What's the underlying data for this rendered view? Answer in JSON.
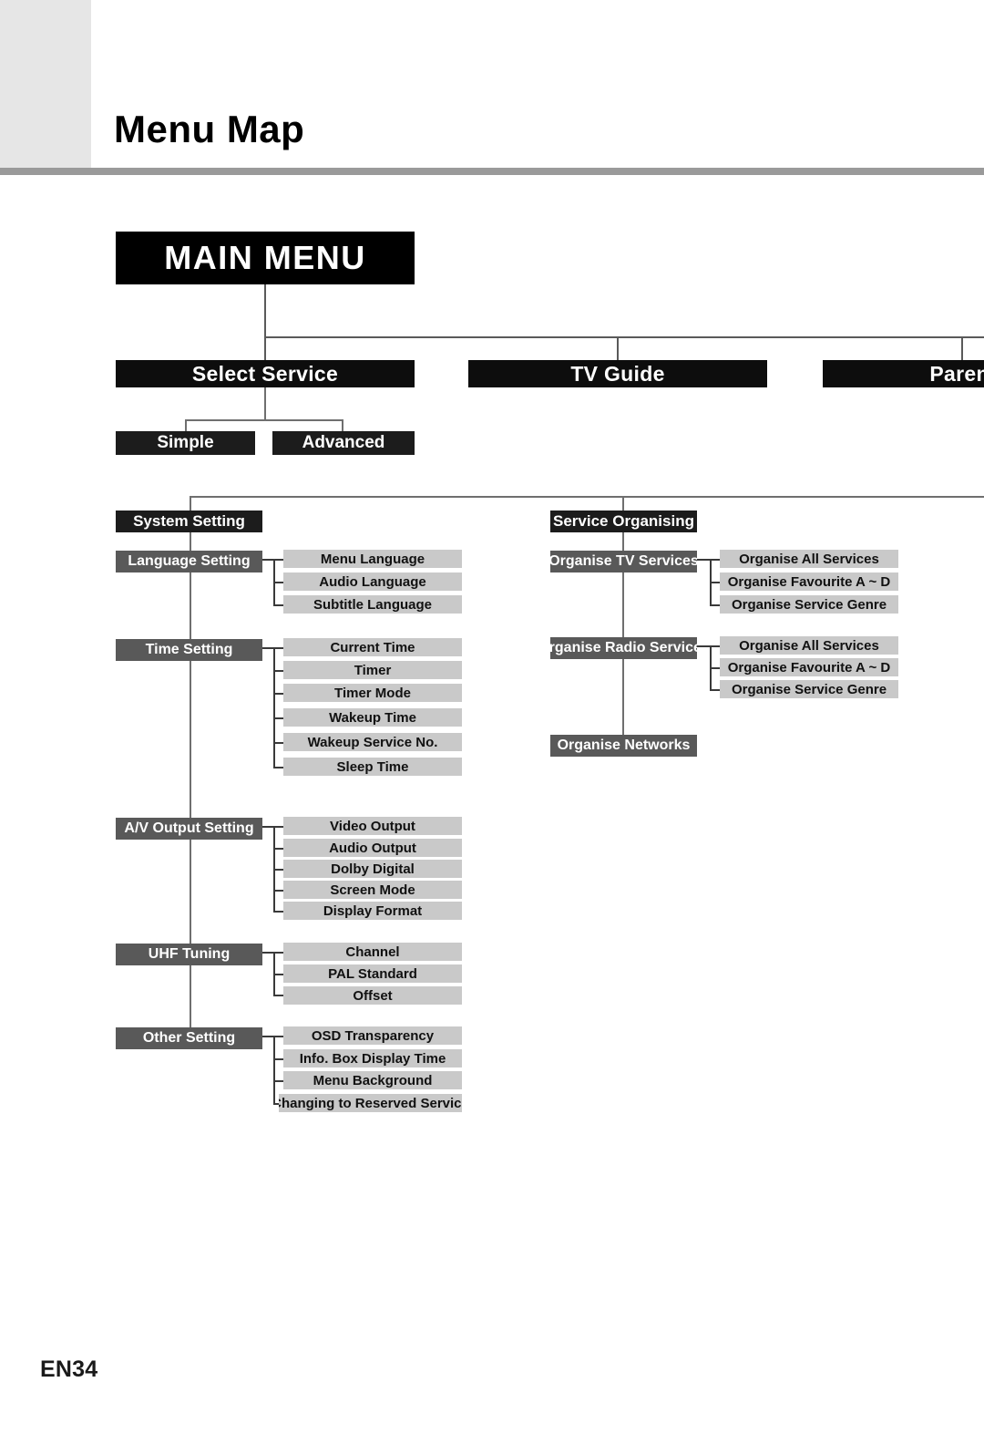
{
  "page": {
    "title": "Menu Map",
    "footer": "EN34"
  },
  "colors": {
    "root_box": "#000000",
    "level1_box": "#0d0d0d",
    "group_box": "#595959",
    "leaf_box": "#c9c9c9",
    "header_rule": "#9a9a9a",
    "corner_block": "#e6e6e6",
    "connector": "#5a5a5a"
  },
  "tree": {
    "root": {
      "label": "MAIN MENU"
    },
    "level1": [
      {
        "label": "Select Service"
      },
      {
        "label": "TV Guide"
      },
      {
        "label": "Parental"
      }
    ],
    "select_service_children": [
      {
        "label": "Simple"
      },
      {
        "label": "Advanced"
      }
    ],
    "sections": [
      {
        "label": "System Setting",
        "groups": [
          {
            "label": "Language Setting",
            "items": [
              {
                "label": "Menu Language"
              },
              {
                "label": "Audio Language"
              },
              {
                "label": "Subtitle Language"
              }
            ]
          },
          {
            "label": "Time Setting",
            "items": [
              {
                "label": "Current Time"
              },
              {
                "label": "Timer"
              },
              {
                "label": "Timer Mode"
              },
              {
                "label": "Wakeup Time"
              },
              {
                "label": "Wakeup Service No."
              },
              {
                "label": "Sleep Time"
              }
            ]
          },
          {
            "label": "A/V Output Setting",
            "items": [
              {
                "label": "Video  Output"
              },
              {
                "label": "Audio Output"
              },
              {
                "label": "Dolby Digital"
              },
              {
                "label": "Screen Mode"
              },
              {
                "label": "Display Format"
              }
            ]
          },
          {
            "label": "UHF Tuning",
            "items": [
              {
                "label": "Channel"
              },
              {
                "label": "PAL Standard"
              },
              {
                "label": "Offset"
              }
            ]
          },
          {
            "label": "Other Setting",
            "items": [
              {
                "label": "OSD Transparency"
              },
              {
                "label": "Info. Box Display Time"
              },
              {
                "label": "Menu Background"
              },
              {
                "label": "Changing to Reserved Service"
              }
            ]
          }
        ]
      },
      {
        "label": "Service Organising",
        "groups": [
          {
            "label": "Organise TV Services",
            "items": [
              {
                "label": "Organise All Services"
              },
              {
                "label": "Organise Favourite A ~ D"
              },
              {
                "label": "Organise  Service Genre"
              }
            ]
          },
          {
            "label": "Organise Radio Services",
            "items": [
              {
                "label": "Organise All Services"
              },
              {
                "label": "Organise Favourite A ~ D"
              },
              {
                "label": "Organise  Service Genre"
              }
            ]
          },
          {
            "label": "Organise Networks",
            "items": []
          }
        ]
      }
    ]
  }
}
